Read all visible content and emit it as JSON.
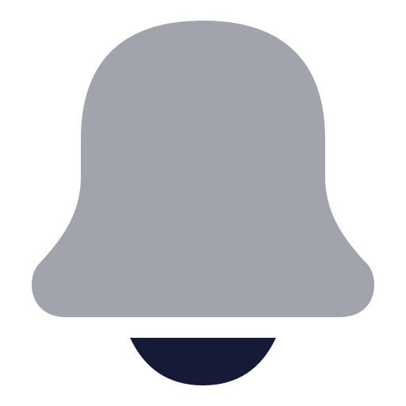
{
  "icon": {
    "name": "bell-icon",
    "colors": {
      "body": "#A1A3AD",
      "clapper": "#151B36",
      "background": "#FFFFFF"
    }
  }
}
